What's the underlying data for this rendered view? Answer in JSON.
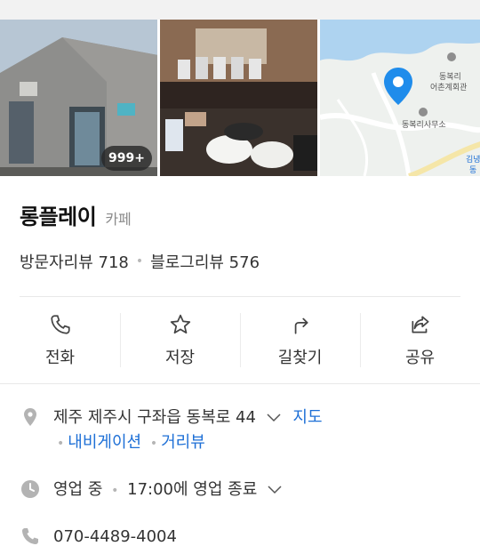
{
  "photos": {
    "count_badge": "999+"
  },
  "map": {
    "label_village_center_1": "동복리",
    "label_village_center_2": "어촌계회관",
    "label_office": "동복리사무소",
    "label_edge_1": "김녕",
    "label_edge_2": "동"
  },
  "place": {
    "name": "롱플레이",
    "category": "카페",
    "visitor_reviews": "방문자리뷰 718",
    "blog_reviews": "블로그리뷰 576"
  },
  "actions": [
    {
      "label": "전화",
      "icon": "phone-icon"
    },
    {
      "label": "저장",
      "icon": "star-icon"
    },
    {
      "label": "길찾기",
      "icon": "directions-icon"
    },
    {
      "label": "공유",
      "icon": "share-icon"
    }
  ],
  "info": {
    "address": "제주 제주시 구좌읍 동복로 44",
    "map_link": "지도",
    "navigation_link": "내비게이션",
    "streetview_link": "거리뷰",
    "hours_status": "영업 중",
    "hours_detail": "17:00에 영업 종료",
    "phone": "070-4489-4004"
  },
  "colors": {
    "link": "#1d6fd6",
    "pin": "#1f8ceb"
  }
}
